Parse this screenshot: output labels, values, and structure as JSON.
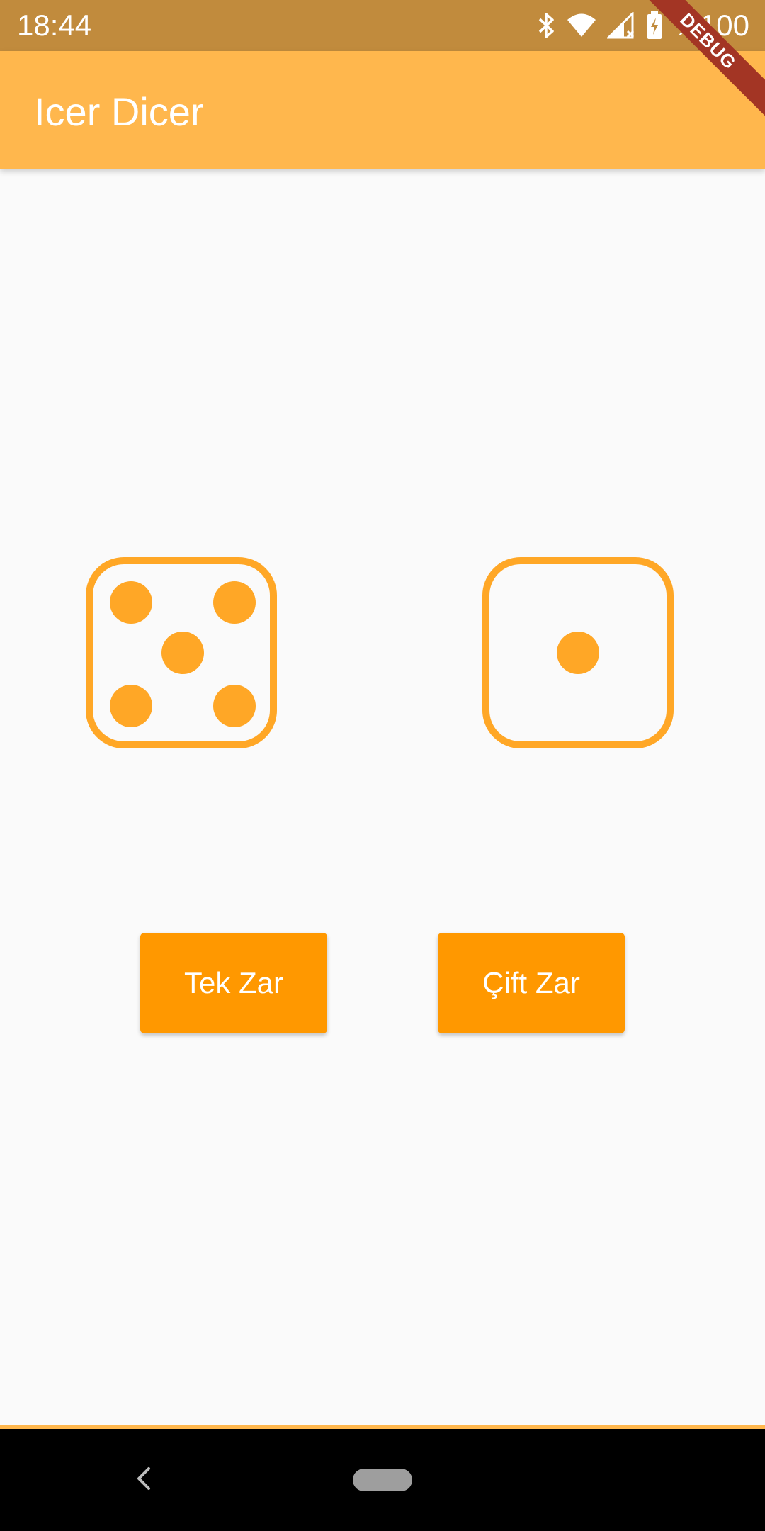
{
  "status_bar": {
    "time": "18:44",
    "battery_text": "%100",
    "icons": [
      "bluetooth-icon",
      "wifi-icon",
      "cell-signal-icon",
      "battery-charging-icon"
    ]
  },
  "debug_banner": {
    "label": "DEBUG"
  },
  "app_bar": {
    "title": "Icer Dicer"
  },
  "dice": [
    {
      "name": "left-die",
      "value": 5
    },
    {
      "name": "right-die",
      "value": 1
    }
  ],
  "buttons": {
    "single_die": "Tek Zar",
    "double_dice": "Çift Zar"
  },
  "nav_bar": {
    "icons": [
      "back-icon",
      "home-pill-icon"
    ]
  },
  "colors": {
    "status_bar": "#c18b3d",
    "app_bar": "#ffb74d",
    "dice": "#ffa726",
    "button": "#ff9800",
    "background": "#fafafa"
  }
}
